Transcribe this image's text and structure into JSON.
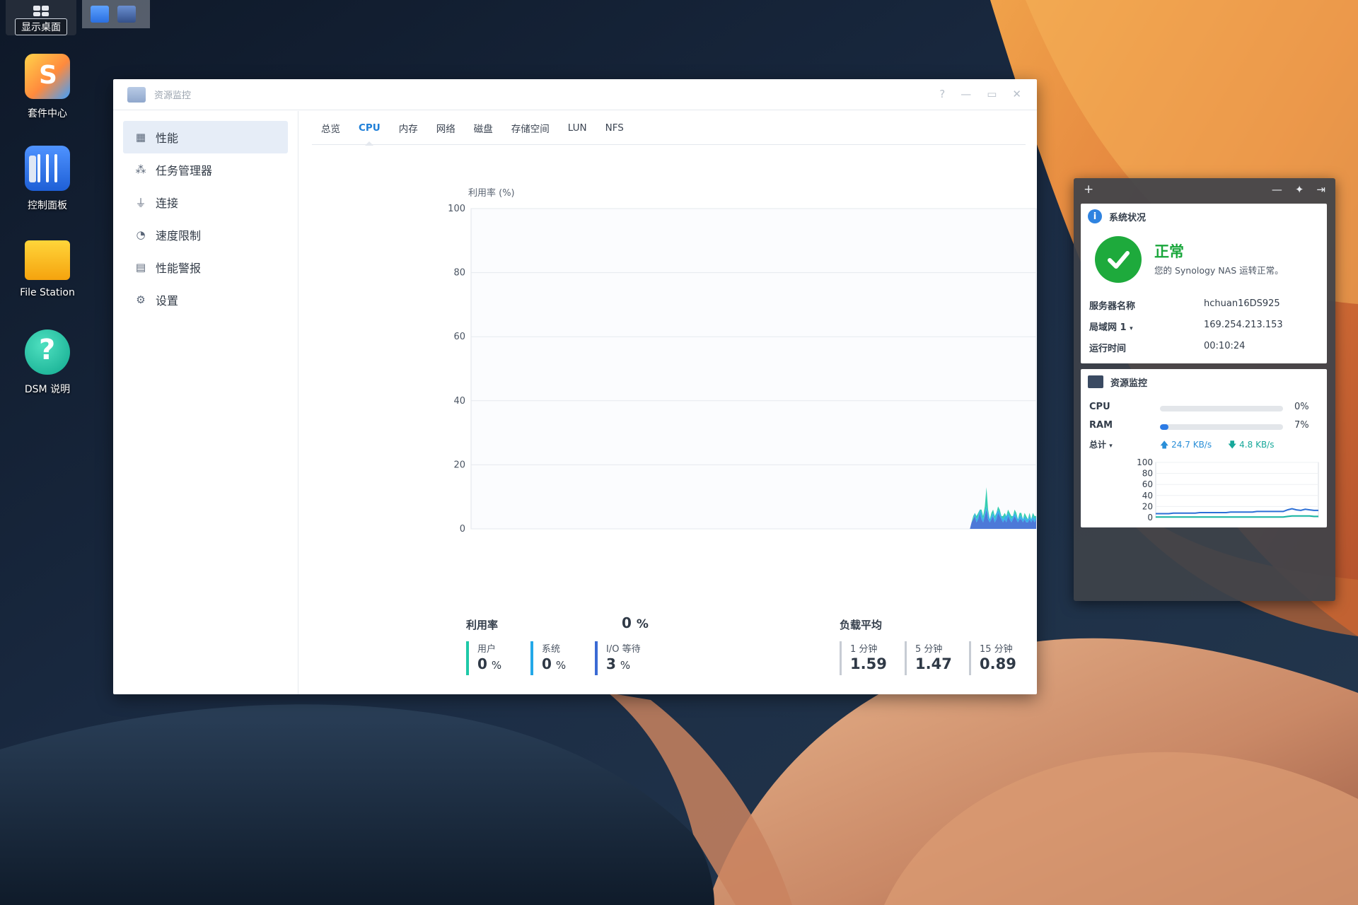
{
  "taskbar": {
    "show_desktop_label": "显示桌面"
  },
  "desktop": {
    "icons": [
      {
        "label": "套件中心",
        "icon": "package-center-icon"
      },
      {
        "label": "控制面板",
        "icon": "control-panel-icon"
      },
      {
        "label": "File Station",
        "icon": "folder-icon"
      },
      {
        "label": "DSM 说明",
        "icon": "help-icon"
      }
    ]
  },
  "window": {
    "title": "资源监控",
    "sidebar": [
      {
        "label": "性能",
        "icon": "performance-icon",
        "active": true
      },
      {
        "label": "任务管理器",
        "icon": "task-manager-icon"
      },
      {
        "label": "连接",
        "icon": "plug-icon"
      },
      {
        "label": "速度限制",
        "icon": "speed-limit-icon"
      },
      {
        "label": "性能警报",
        "icon": "alert-icon"
      },
      {
        "label": "设置",
        "icon": "gear-icon"
      }
    ],
    "tabs": [
      "总览",
      "CPU",
      "内存",
      "网络",
      "磁盘",
      "存储空间",
      "LUN",
      "NFS"
    ],
    "active_tab": "CPU"
  },
  "chart_data": {
    "type": "area",
    "ylabel": "利用率 (%)",
    "ylim": [
      0,
      100
    ],
    "yticks": [
      0,
      20,
      40,
      60,
      80,
      100
    ],
    "grid": true,
    "colors": {
      "user": "#1fc9a8",
      "system": "#23a8e8",
      "io_wait": "#3a6ad4"
    },
    "series": [
      {
        "name": "I/O 等待",
        "key": "io_wait",
        "values": [
          0,
          0,
          0,
          0,
          0,
          0,
          0,
          0,
          0,
          0,
          0,
          0,
          0,
          0,
          0,
          0,
          0,
          0,
          0,
          0,
          0,
          0,
          0,
          0,
          0,
          0,
          0,
          0,
          0,
          0,
          0,
          0,
          0,
          0,
          0,
          0,
          0,
          0,
          0,
          0,
          0,
          0,
          0,
          0,
          0,
          0,
          0,
          0,
          0,
          0,
          0,
          0,
          0,
          0,
          0,
          0,
          0,
          0,
          0,
          0,
          0,
          0,
          0,
          0,
          0,
          0,
          0,
          0,
          0,
          0,
          0,
          0,
          0,
          0,
          0,
          0,
          0,
          0,
          0,
          0,
          0,
          0,
          0,
          0,
          0,
          0,
          0,
          0,
          0,
          0,
          0,
          0,
          0,
          0,
          0,
          0,
          0,
          0,
          0,
          0,
          0,
          0,
          0,
          0,
          0,
          0,
          0,
          0,
          0,
          0,
          0,
          0,
          0,
          0,
          0,
          0,
          0,
          0,
          0,
          0,
          0,
          0,
          0,
          0,
          0,
          0,
          0,
          0,
          0,
          0,
          0,
          0,
          0,
          0,
          0,
          0,
          0,
          0,
          0,
          0,
          0,
          0,
          0,
          0,
          0,
          0,
          0,
          0,
          0,
          0,
          0,
          0,
          0,
          0,
          0,
          0,
          0,
          0,
          0,
          0,
          0,
          0,
          0,
          0,
          0,
          0,
          0,
          0,
          0,
          0,
          0,
          0,
          0,
          0,
          0,
          0,
          0,
          0,
          0,
          0,
          0,
          0,
          0,
          0,
          0,
          0,
          0,
          0,
          0,
          0,
          0,
          0,
          0,
          0,
          0,
          0,
          0,
          0,
          0,
          0,
          0,
          0,
          0,
          0,
          0,
          0,
          0,
          0,
          0,
          0,
          0,
          0,
          0,
          0,
          0,
          0,
          0,
          0,
          0,
          0,
          0,
          0,
          0,
          0,
          0,
          0,
          0,
          0,
          0,
          0,
          0,
          0,
          0,
          0,
          0,
          0,
          0,
          0,
          0,
          0,
          0,
          0,
          0,
          0,
          0,
          0,
          0,
          0,
          0,
          0,
          0,
          0,
          0,
          0,
          0,
          0,
          0,
          0,
          0,
          0,
          0,
          0,
          0,
          0,
          0,
          0,
          0,
          0,
          0,
          0,
          0,
          0,
          0,
          0,
          0,
          0,
          0,
          0,
          0,
          0,
          0,
          0,
          0,
          0,
          0,
          0,
          0,
          0,
          0,
          0,
          0,
          0,
          0,
          0,
          0,
          0,
          0,
          0,
          0,
          0,
          0,
          0,
          2,
          3,
          4,
          2,
          3,
          5,
          3,
          2,
          4,
          6,
          3,
          2,
          3,
          4,
          2,
          3,
          5,
          4,
          3,
          2,
          3,
          2,
          4,
          3,
          2,
          3,
          4,
          3,
          2,
          3,
          3,
          2,
          3,
          2,
          2,
          3,
          2,
          3,
          2,
          3
        ]
      },
      {
        "name": "系统",
        "key": "system",
        "values": [
          0,
          0,
          0,
          0,
          0,
          0,
          0,
          0,
          0,
          0,
          0,
          0,
          0,
          0,
          0,
          0,
          0,
          0,
          0,
          0,
          0,
          0,
          0,
          0,
          0,
          0,
          0,
          0,
          0,
          0,
          0,
          0,
          0,
          0,
          0,
          0,
          0,
          0,
          0,
          0,
          0,
          0,
          0,
          0,
          0,
          0,
          0,
          0,
          0,
          0,
          0,
          0,
          0,
          0,
          0,
          0,
          0,
          0,
          0,
          0,
          0,
          0,
          0,
          0,
          0,
          0,
          0,
          0,
          0,
          0,
          0,
          0,
          0,
          0,
          0,
          0,
          0,
          0,
          0,
          0,
          0,
          0,
          0,
          0,
          0,
          0,
          0,
          0,
          0,
          0,
          0,
          0,
          0,
          0,
          0,
          0,
          0,
          0,
          0,
          0,
          0,
          0,
          0,
          0,
          0,
          0,
          0,
          0,
          0,
          0,
          0,
          0,
          0,
          0,
          0,
          0,
          0,
          0,
          0,
          0,
          0,
          0,
          0,
          0,
          0,
          0,
          0,
          0,
          0,
          0,
          0,
          0,
          0,
          0,
          0,
          0,
          0,
          0,
          0,
          0,
          0,
          0,
          0,
          0,
          0,
          0,
          0,
          0,
          0,
          0,
          0,
          0,
          0,
          0,
          0,
          0,
          0,
          0,
          0,
          0,
          0,
          0,
          0,
          0,
          0,
          0,
          0,
          0,
          0,
          0,
          0,
          0,
          0,
          0,
          0,
          0,
          0,
          0,
          0,
          0,
          0,
          0,
          0,
          0,
          0,
          0,
          0,
          0,
          0,
          0,
          0,
          0,
          0,
          0,
          0,
          0,
          0,
          0,
          0,
          0,
          0,
          0,
          0,
          0,
          0,
          0,
          0,
          0,
          0,
          0,
          0,
          0,
          0,
          0,
          0,
          0,
          0,
          0,
          0,
          0,
          0,
          0,
          0,
          0,
          0,
          0,
          0,
          0,
          0,
          0,
          0,
          0,
          0,
          0,
          0,
          0,
          0,
          0,
          0,
          0,
          0,
          0,
          0,
          0,
          0,
          0,
          0,
          0,
          0,
          0,
          0,
          0,
          0,
          0,
          0,
          0,
          0,
          0,
          0,
          0,
          0,
          0,
          0,
          0,
          0,
          0,
          0,
          0,
          0,
          0,
          0,
          0,
          0,
          0,
          0,
          0,
          0,
          0,
          0,
          0,
          0,
          0,
          0,
          0,
          0,
          0,
          0,
          0,
          0,
          0,
          0,
          0,
          0,
          0,
          0,
          0,
          0,
          0,
          0,
          0,
          0,
          0,
          0,
          0,
          1,
          1,
          1,
          1,
          2,
          1,
          1,
          1,
          2,
          1,
          1,
          1,
          1,
          2,
          1,
          1,
          1,
          1,
          1,
          2,
          1,
          1,
          1,
          1,
          1,
          1,
          1,
          1,
          1,
          1,
          1,
          1,
          1,
          1,
          1,
          1,
          1,
          1,
          1
        ]
      },
      {
        "name": "用户",
        "key": "user",
        "values": [
          0,
          0,
          0,
          0,
          0,
          0,
          0,
          0,
          0,
          0,
          0,
          0,
          0,
          0,
          0,
          0,
          0,
          0,
          0,
          0,
          0,
          0,
          0,
          0,
          0,
          0,
          0,
          0,
          0,
          0,
          0,
          0,
          0,
          0,
          0,
          0,
          0,
          0,
          0,
          0,
          0,
          0,
          0,
          0,
          0,
          0,
          0,
          0,
          0,
          0,
          0,
          0,
          0,
          0,
          0,
          0,
          0,
          0,
          0,
          0,
          0,
          0,
          0,
          0,
          0,
          0,
          0,
          0,
          0,
          0,
          0,
          0,
          0,
          0,
          0,
          0,
          0,
          0,
          0,
          0,
          0,
          0,
          0,
          0,
          0,
          0,
          0,
          0,
          0,
          0,
          0,
          0,
          0,
          0,
          0,
          0,
          0,
          0,
          0,
          0,
          0,
          0,
          0,
          0,
          0,
          0,
          0,
          0,
          0,
          0,
          0,
          0,
          0,
          0,
          0,
          0,
          0,
          0,
          0,
          0,
          0,
          0,
          0,
          0,
          0,
          0,
          0,
          0,
          0,
          0,
          0,
          0,
          0,
          0,
          0,
          0,
          0,
          0,
          0,
          0,
          0,
          0,
          0,
          0,
          0,
          0,
          0,
          0,
          0,
          0,
          0,
          0,
          0,
          0,
          0,
          0,
          0,
          0,
          0,
          0,
          0,
          0,
          0,
          0,
          0,
          0,
          0,
          0,
          0,
          0,
          0,
          0,
          0,
          0,
          0,
          0,
          0,
          0,
          0,
          0,
          0,
          0,
          0,
          0,
          0,
          0,
          0,
          0,
          0,
          0,
          0,
          0,
          0,
          0,
          0,
          0,
          0,
          0,
          0,
          0,
          0,
          0,
          0,
          0,
          0,
          0,
          0,
          0,
          0,
          0,
          0,
          0,
          0,
          0,
          0,
          0,
          0,
          0,
          0,
          0,
          0,
          0,
          0,
          0,
          0,
          0,
          0,
          0,
          0,
          0,
          0,
          0,
          0,
          0,
          0,
          0,
          0,
          0,
          0,
          0,
          0,
          0,
          0,
          0,
          0,
          0,
          0,
          0,
          0,
          0,
          0,
          0,
          0,
          0,
          0,
          0,
          0,
          0,
          0,
          0,
          0,
          0,
          0,
          0,
          0,
          0,
          0,
          0,
          0,
          0,
          0,
          0,
          0,
          0,
          0,
          0,
          0,
          0,
          0,
          0,
          0,
          0,
          0,
          0,
          0,
          0,
          0,
          0,
          0,
          0,
          0,
          0,
          0,
          0,
          0,
          0,
          0,
          0,
          0,
          0,
          0,
          0,
          0,
          1,
          0,
          1,
          1,
          0,
          1,
          1,
          2,
          6,
          1,
          0,
          1,
          1,
          1,
          0,
          1,
          1,
          0,
          1,
          1,
          0,
          1,
          1,
          1,
          0,
          1,
          1,
          0,
          1,
          1,
          0,
          1,
          1,
          0,
          1,
          0,
          1,
          1,
          0
        ]
      }
    ]
  },
  "stats": {
    "utilization_label": "利用率",
    "utilization_value": "0",
    "utilization_unit": "%",
    "user_label": "用户",
    "user_value": "0",
    "system_label": "系统",
    "system_value": "0",
    "io_label": "I/O 等待",
    "io_value": "3",
    "pct_unit": "%",
    "load_label": "负载平均",
    "load_1_label": "1 分钟",
    "load_1_value": "1.59",
    "load_5_label": "5 分钟",
    "load_5_value": "1.47",
    "load_15_label": "15 分钟",
    "load_15_value": "0.89"
  },
  "widget": {
    "system_status": {
      "header": "系统状况",
      "status": "正常",
      "description": "您的 Synology NAS 运转正常。",
      "server_name_label": "服务器名称",
      "server_name": "hchuan16DS925",
      "lan_label": "局域网 1",
      "lan_ip": "169.254.213.153",
      "uptime_label": "运行时间",
      "uptime": "00:10:24"
    },
    "resource_monitor": {
      "header": "资源监控",
      "cpu_label": "CPU",
      "cpu_pct": 0,
      "cpu_text": "0%",
      "ram_label": "RAM",
      "ram_pct": 7,
      "ram_text": "7%",
      "net_label": "总计",
      "upload": "24.7 KB/s",
      "download": "4.8 KB/s",
      "chart_data": {
        "type": "line",
        "ylim": [
          0,
          100
        ],
        "yticks": [
          0,
          20,
          40,
          60,
          80,
          100
        ],
        "series": [
          {
            "name": "RAM",
            "color": "#2c6fd6",
            "values": [
              7,
              7,
              7,
              7,
              8,
              8,
              8,
              8,
              8,
              8,
              9,
              9,
              9,
              9,
              9,
              9,
              9,
              10,
              10,
              10,
              10,
              10,
              10,
              11,
              11,
              11,
              11,
              11,
              11,
              11,
              14,
              16,
              14,
              13,
              15,
              14,
              13,
              13
            ]
          },
          {
            "name": "CPU",
            "color": "#14b4a0",
            "values": [
              1,
              1,
              1,
              1,
              1,
              1,
              1,
              1,
              1,
              1,
              1,
              1,
              1,
              1,
              1,
              1,
              1,
              1,
              1,
              1,
              1,
              1,
              1,
              1,
              1,
              1,
              1,
              1,
              1,
              1,
              2,
              3,
              3,
              3,
              3,
              3,
              2,
              2
            ]
          }
        ]
      }
    }
  }
}
